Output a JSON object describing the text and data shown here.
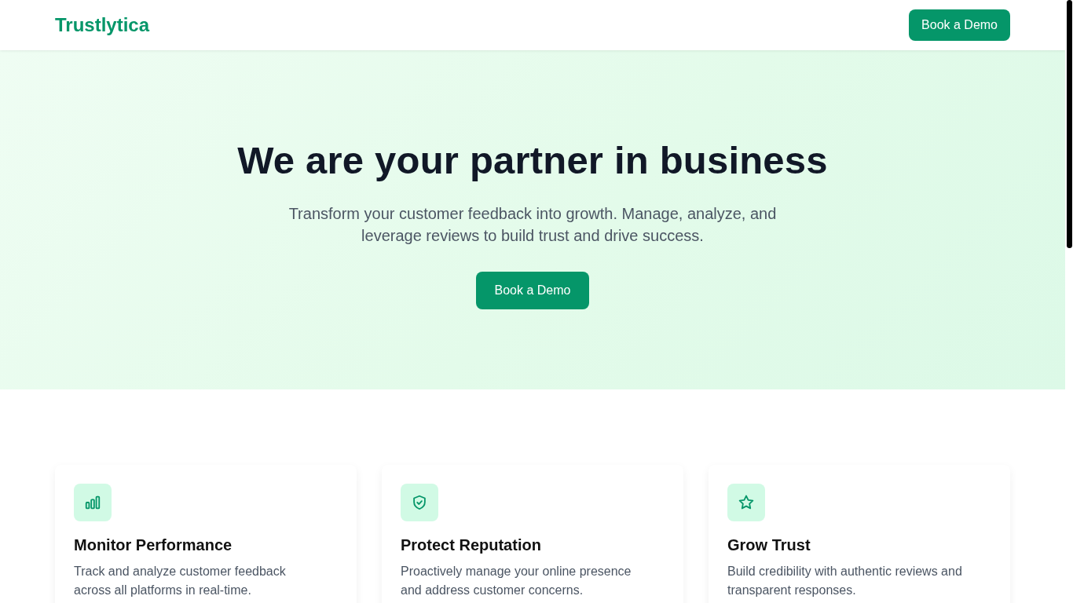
{
  "header": {
    "logo": "Trustlytica",
    "button": "Book a Demo"
  },
  "hero": {
    "title": "We are your partner in business",
    "subtitle": "Transform your customer feedback into growth. Manage, analyze, and leverage reviews to build trust and drive success.",
    "button": "Book a Demo"
  },
  "features": [
    {
      "title": "Monitor Performance",
      "text": "Track and analyze customer feedback across all platforms in real-time."
    },
    {
      "title": "Protect Reputation",
      "text": "Proactively manage your online presence and address customer concerns."
    },
    {
      "title": "Grow Trust",
      "text": "Build credibility with authentic reviews and transparent responses."
    }
  ]
}
